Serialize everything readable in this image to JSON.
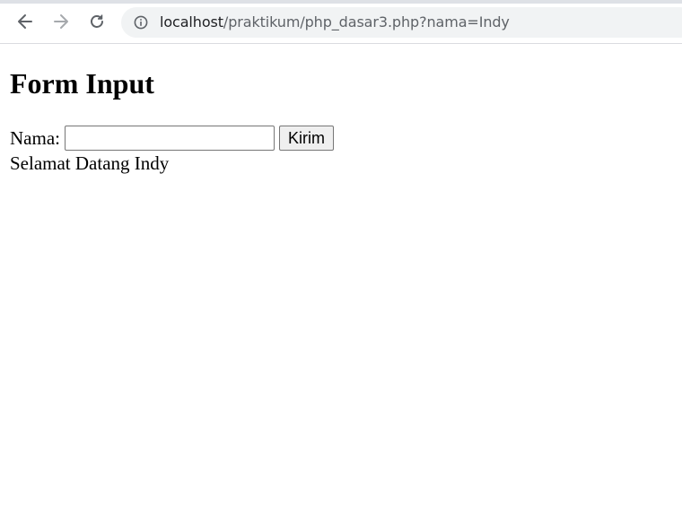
{
  "browser": {
    "url_host": "localhost",
    "url_path": "/praktikum/php_dasar3.php?nama=Indy",
    "icons": {
      "back": "arrow-left-icon",
      "forward": "arrow-right-icon",
      "reload": "reload-icon",
      "site_info": "info-icon"
    }
  },
  "page": {
    "title": "Form Input",
    "form": {
      "label": "Nama:",
      "input_value": "",
      "submit_label": "Kirim"
    },
    "greeting": "Selamat Datang Indy"
  }
}
